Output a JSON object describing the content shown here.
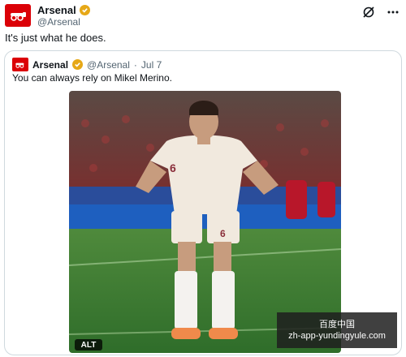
{
  "post": {
    "display_name": "Arsenal",
    "handle": "@Arsenal",
    "text": "It's just what he does.",
    "avatar_icon": "arsenal-cannon-icon",
    "verified_icon": "verified-badge-icon",
    "actions": [
      "grok-icon",
      "more-icon"
    ]
  },
  "quote": {
    "display_name": "Arsenal",
    "handle": "@Arsenal",
    "separator": "·",
    "date": "Jul 7",
    "text": "You can always rely on Mikel Merino."
  },
  "media": {
    "alt_label": "ALT",
    "jersey_number": "6"
  },
  "watermark": {
    "line1": "百度中国",
    "line2": "zh-app-yundingyule.com"
  },
  "colors": {
    "brand_red": "#db0007",
    "verified_gold": "#e6a817",
    "secondary_text": "#536471"
  }
}
